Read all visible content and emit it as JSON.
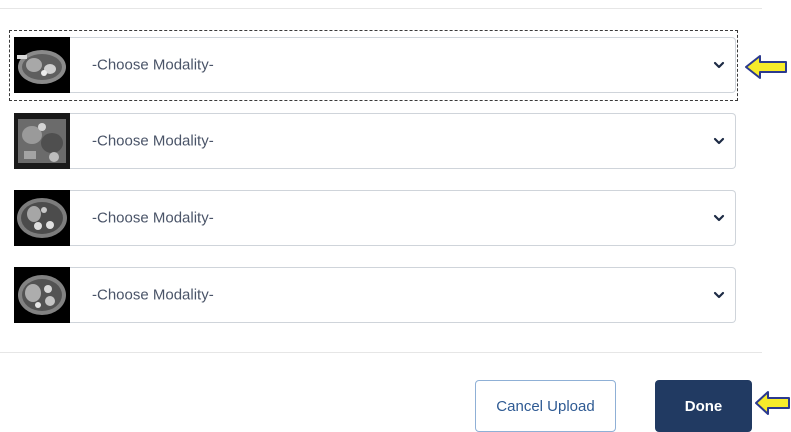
{
  "images": [
    {
      "modality_value": "-Choose Modality-",
      "thumbnail_icon": "ct-scan-thumbnail-icon",
      "focused": true
    },
    {
      "modality_value": "-Choose Modality-",
      "thumbnail_icon": "ct-scan-thumbnail-icon",
      "focused": false
    },
    {
      "modality_value": "-Choose Modality-",
      "thumbnail_icon": "ct-scan-thumbnail-icon",
      "focused": false
    },
    {
      "modality_value": "-Choose Modality-",
      "thumbnail_icon": "ct-scan-thumbnail-icon",
      "focused": false
    }
  ],
  "actions": {
    "cancel_label": "Cancel Upload",
    "done_label": "Done"
  },
  "annotations": {
    "arrow_icon": "yellow-left-arrow-icon",
    "arrow_color": "#f7ec2a",
    "arrow_outline": "#2b3a8f"
  },
  "colors": {
    "primary": "#213a62",
    "secondary_border": "#8fb0d6",
    "select_text": "#4a5468"
  }
}
